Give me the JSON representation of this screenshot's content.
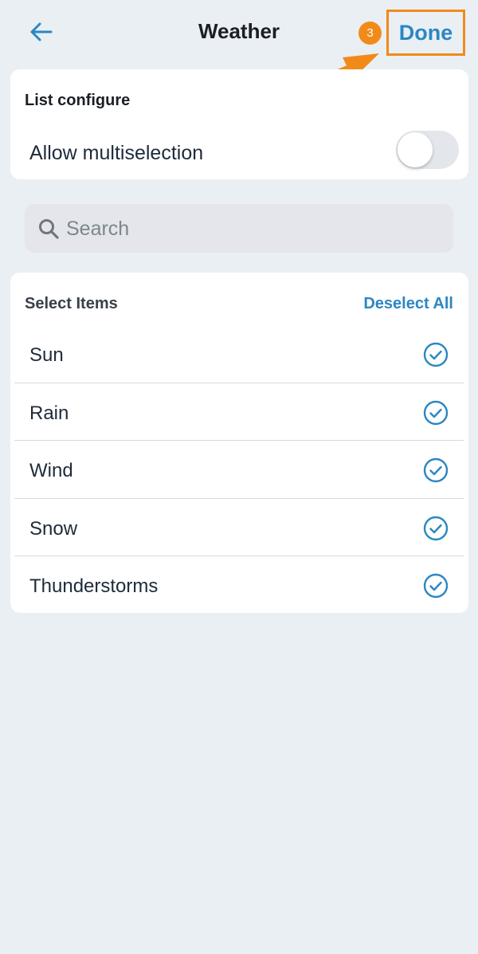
{
  "header": {
    "title": "Weather",
    "back_icon": "arrow-left-icon",
    "done_label": "Done",
    "step_badge": "3"
  },
  "config": {
    "section_title": "List configure",
    "multiselection_label": "Allow multiselection",
    "multiselection_enabled": false
  },
  "search": {
    "placeholder": "Search",
    "value": "",
    "icon": "search-icon"
  },
  "items": {
    "header_label": "Select Items",
    "deselect_label": "Deselect All",
    "list": [
      {
        "label": "Sun",
        "selected": true
      },
      {
        "label": "Rain",
        "selected": true
      },
      {
        "label": "Wind",
        "selected": true
      },
      {
        "label": "Snow",
        "selected": true
      },
      {
        "label": "Thunderstorms",
        "selected": true
      }
    ]
  },
  "colors": {
    "background": "#EAEFF4",
    "accent": "#2B87C2",
    "annotation": "#F28A1A",
    "card": "#FFFFFF"
  }
}
